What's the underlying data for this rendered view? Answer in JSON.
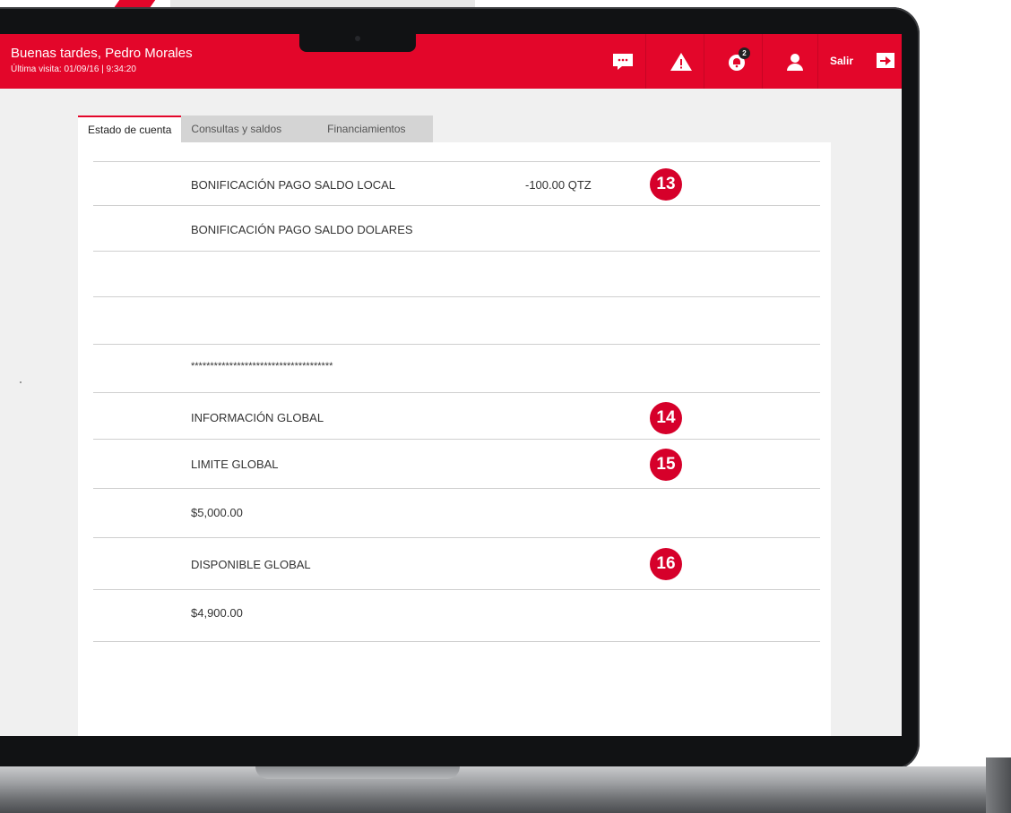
{
  "header": {
    "greeting": "Buenas tardes, Pedro Morales",
    "last_visit": "Última visita: 01/09/16  |  9:34:20",
    "notification_count": "2",
    "logout_label": "Salir",
    "icons": [
      "chat-icon",
      "warning-icon",
      "bell-icon",
      "user-icon",
      "exit-arrow-icon"
    ]
  },
  "tabs": [
    {
      "label": "Estado de cuenta",
      "active": true
    },
    {
      "label": "Consultas y saldos",
      "active": false
    },
    {
      "label": "Financiamientos",
      "active": false
    }
  ],
  "rows": [
    {
      "label": "BONIFICACIÓN PAGO SALDO LOCAL",
      "amount": "-100.00 QTZ",
      "marker": "13"
    },
    {
      "label": "BONIFICACIÓN PAGO SALDO DOLARES",
      "amount": "",
      "marker": ""
    },
    {
      "label": "",
      "amount": "",
      "marker": ""
    },
    {
      "label": "",
      "amount": "",
      "marker": ""
    },
    {
      "label": "*************************************",
      "amount": "",
      "marker": ""
    },
    {
      "label": "INFORMACIÓN GLOBAL",
      "amount": "",
      "marker": "14"
    },
    {
      "label": "LIMITE GLOBAL",
      "amount": "",
      "marker": "15"
    },
    {
      "label": "$5,000.00",
      "amount": "",
      "marker": ""
    },
    {
      "label": "DISPONIBLE GLOBAL",
      "amount": "",
      "marker": "16"
    },
    {
      "label": "$4,900.00",
      "amount": "",
      "marker": ""
    }
  ],
  "colors": {
    "brand_red": "#e3062a",
    "marker_red": "#d6002a"
  }
}
